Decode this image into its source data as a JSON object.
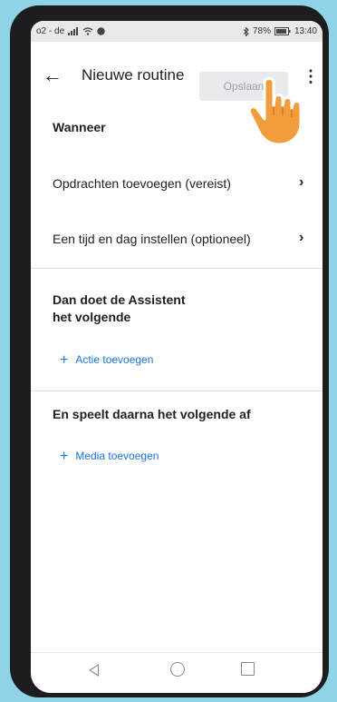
{
  "status": {
    "carrier": "o2 - de",
    "battery": "78%",
    "time": "13:40"
  },
  "appbar": {
    "back_icon": "arrow-left-icon",
    "title": "Nieuwe routine",
    "save_label": "Opslaan",
    "more_icon": "more-vert-icon"
  },
  "when": {
    "heading": "Wanneer",
    "items": [
      {
        "label": "Opdrachten toevoegen (vereist)",
        "icon": "chevron-right-icon"
      },
      {
        "label": "Een tijd en dag instellen (optioneel)",
        "icon": "chevron-right-icon"
      }
    ]
  },
  "then": {
    "heading_line1": "Dan doet de Assistent",
    "heading_line2": "het volgende",
    "add_label": "Actie toevoegen"
  },
  "media": {
    "heading": "En speelt daarna het volgende af",
    "add_label": "Media toevoegen"
  },
  "colors": {
    "accent": "#1a73e8",
    "background": "#8fd3e6",
    "hand": "#f39c3b"
  }
}
